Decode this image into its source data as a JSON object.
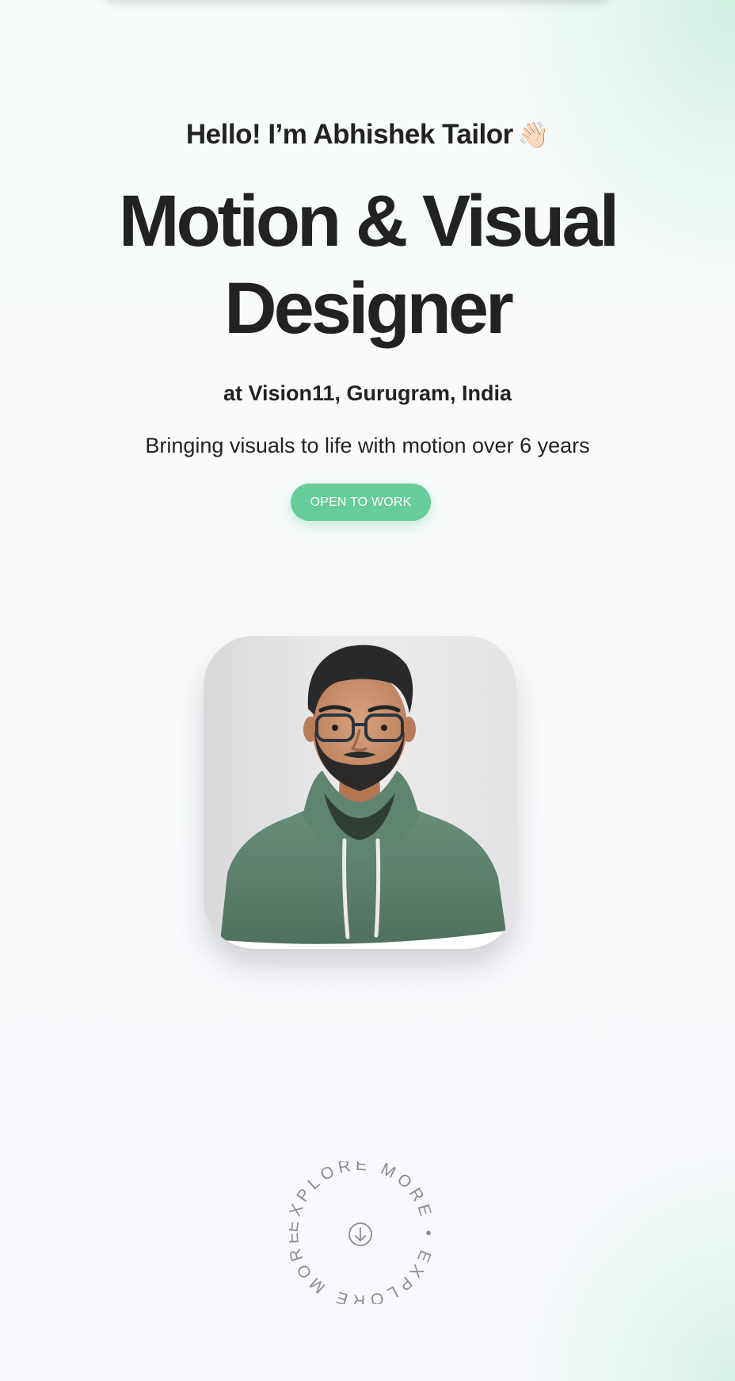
{
  "hero": {
    "greeting": "Hello! I’m Abhishek Tailor",
    "greeting_emoji": "👋🏻",
    "headline_line1": "Motion & Visual",
    "headline_line2": "Designer",
    "company": "at Vision11, Gurugram, India",
    "tagline": "Bringing visuals to life with motion over 6 years",
    "cta_label": "OPEN TO WORK"
  },
  "portrait": {
    "alt": "Portrait of Abhishek Tailor"
  },
  "explore": {
    "ring_text": "EXPLORE MORE • EXPLORE MORE • ",
    "icon": "arrow-down-circle-icon"
  },
  "colors": {
    "accent": "#66cc99",
    "text": "#222222",
    "hoodie": "#5b7f6c",
    "background": "#f8fafc"
  }
}
